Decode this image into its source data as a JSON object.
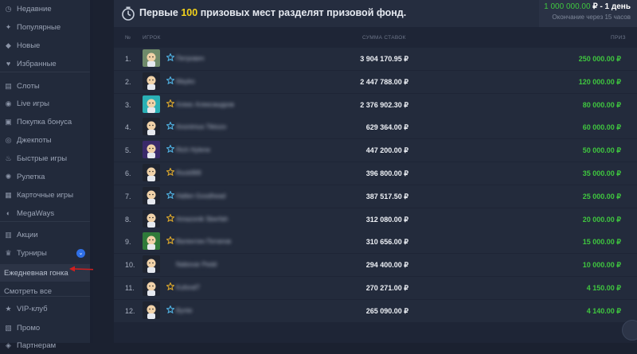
{
  "sidebar": {
    "items": [
      {
        "label": "Недавние",
        "icon": "clock-icon",
        "glyph": "◷"
      },
      {
        "label": "Популярные",
        "icon": "fire-icon",
        "glyph": "✦"
      },
      {
        "label": "Новые",
        "icon": "diamond-icon",
        "glyph": "◆"
      },
      {
        "label": "Избранные",
        "icon": "heart-icon",
        "glyph": "♥"
      },
      {
        "label": "Слоты",
        "icon": "slots-icon",
        "glyph": "▤"
      },
      {
        "label": "Live игры",
        "icon": "live-icon",
        "glyph": "◉"
      },
      {
        "label": "Покупка бонуса",
        "icon": "cart-icon",
        "glyph": "▣"
      },
      {
        "label": "Джекпоты",
        "icon": "jackpot-icon",
        "glyph": "◎"
      },
      {
        "label": "Быстрые игры",
        "icon": "flame-icon",
        "glyph": "♨"
      },
      {
        "label": "Рулетка",
        "icon": "roulette-icon",
        "glyph": "✺"
      },
      {
        "label": "Карточные игры",
        "icon": "cards-icon",
        "glyph": "▦"
      },
      {
        "label": "MegaWays",
        "icon": "megaways-icon",
        "glyph": "◐"
      },
      {
        "label": "Акции",
        "icon": "gift-icon",
        "glyph": "▥"
      },
      {
        "label": "Турниры",
        "icon": "trophy-icon",
        "glyph": "♛"
      },
      {
        "label": "Ежедневная гонка",
        "icon": "",
        "glyph": ""
      },
      {
        "label": "Смотреть все",
        "icon": "",
        "glyph": ""
      },
      {
        "label": "VIP-клуб",
        "icon": "star-icon",
        "glyph": "★"
      },
      {
        "label": "Промо",
        "icon": "promo-icon",
        "glyph": "▧"
      },
      {
        "label": "Партнерам",
        "icon": "partners-icon",
        "glyph": "◈"
      }
    ]
  },
  "header": {
    "text_before": "Первые ",
    "highlight": "100",
    "text_after": " призовых мест разделят призовой фонд.",
    "prize_amount": "1 000 000.00",
    "prize_rest": " ₽ - 1 день",
    "ends_in": "Окончание через 15 часов"
  },
  "table": {
    "columns": [
      "№",
      "ИГРОК",
      "СУММА СТАВОК",
      "ПРИЗ"
    ],
    "rows": [
      {
        "rank": "1.",
        "name": "Петрович",
        "bet": "3 904 170.95 ₽",
        "prize": "250 000.00 ₽",
        "star": "blue",
        "avatar": "#6f8a6a"
      },
      {
        "rank": "2.",
        "name": "Mayko",
        "bet": "2 447 788.00 ₽",
        "prize": "120 000.00 ₽",
        "star": "blue",
        "avatar": "#1f2430"
      },
      {
        "rank": "3.",
        "name": "Алекс Александров",
        "bet": "2 376 902.30 ₽",
        "prize": "80 000.00 ₽",
        "star": "gold",
        "avatar": "#2ab0b5"
      },
      {
        "rank": "4.",
        "name": "Anonimus Tiktozo",
        "bet": "629 364.00 ₽",
        "prize": "60 000.00 ₽",
        "star": "blue",
        "avatar": "#1f2430"
      },
      {
        "rank": "5.",
        "name": "Rich Hylene",
        "bet": "447 200.00 ₽",
        "prize": "50 000.00 ₽",
        "star": "blue",
        "avatar": "#3a2a6a"
      },
      {
        "rank": "6.",
        "name": "Rock999",
        "bet": "396 800.00 ₽",
        "prize": "35 000.00 ₽",
        "star": "gold",
        "avatar": "#1f2430"
      },
      {
        "rank": "7.",
        "name": "Hallen Goodhead",
        "bet": "387 517.50 ₽",
        "prize": "25 000.00 ₽",
        "star": "blue",
        "avatar": "#1f2430"
      },
      {
        "rank": "8.",
        "name": "Amazonik Sberfah",
        "bet": "312 080.00 ₽",
        "prize": "20 000.00 ₽",
        "star": "gold",
        "avatar": "#1f2430"
      },
      {
        "rank": "9.",
        "name": "Валентин Потапов",
        "bet": "310 656.00 ₽",
        "prize": "15 000.00 ₽",
        "star": "gold",
        "avatar": "#2f7a3a"
      },
      {
        "rank": "10.",
        "name": "Nabovar Pedd",
        "bet": "294 400.00 ₽",
        "prize": "10 000.00 ₽",
        "star": "none",
        "avatar": "#1f2430"
      },
      {
        "rank": "11.",
        "name": "Kuforaf7",
        "bet": "270 271.00 ₽",
        "prize": "4 150.00 ₽",
        "star": "gold",
        "avatar": "#1f2430"
      },
      {
        "rank": "12.",
        "name": "Bynte",
        "bet": "265 090.00 ₽",
        "prize": "4 140.00 ₽",
        "star": "blue",
        "avatar": "#1f2430"
      }
    ]
  },
  "colors": {
    "prize_green": "#3fc63f",
    "highlight_yellow": "#f3d21b",
    "star_blue": "#4fb0e0",
    "star_gold": "#d9a62c",
    "arrow_red": "#d21f1f"
  }
}
